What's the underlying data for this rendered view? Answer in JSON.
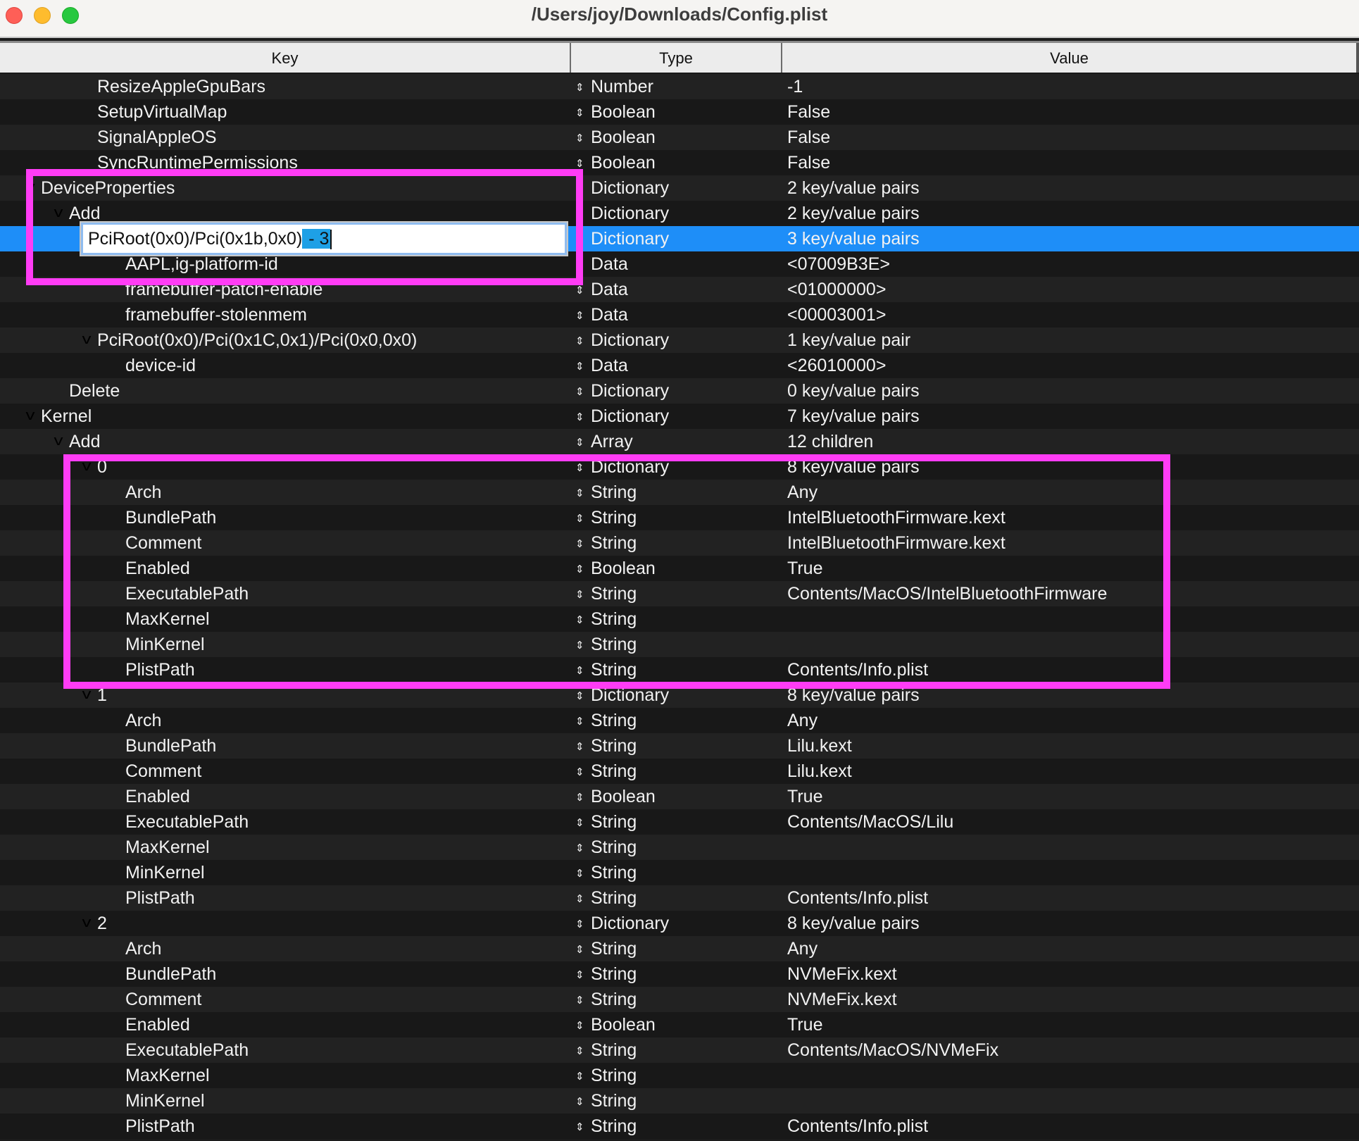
{
  "window": {
    "title": "/Users/joy/Downloads/Config.plist"
  },
  "columns": {
    "key": "Key",
    "type": "Type",
    "value": "Value"
  },
  "icons": {
    "type_stepper": "⇕",
    "disclosure_expanded": "v"
  },
  "colors": {
    "selection": "#1e8ef8",
    "highlight_box": "#ff3cf5",
    "row_light": "#222222",
    "row_dark": "#181818"
  },
  "editing": {
    "text_before": "PciRoot(0x0)/Pci(0x1b,0x0)",
    "text_selected": " - 3"
  },
  "rows": [
    {
      "key": "ResizeAppleGpuBars",
      "level": 2,
      "expanded": false,
      "type": "Number",
      "value": "-1"
    },
    {
      "key": "SetupVirtualMap",
      "level": 2,
      "expanded": false,
      "type": "Boolean",
      "value": "False"
    },
    {
      "key": "SignalAppleOS",
      "level": 2,
      "expanded": false,
      "type": "Boolean",
      "value": "False"
    },
    {
      "key": "SyncRuntimePermissions",
      "level": 2,
      "expanded": false,
      "type": "Boolean",
      "value": "False"
    },
    {
      "key": "DeviceProperties",
      "level": 0,
      "expanded": true,
      "type": "Dictionary",
      "value": "2 key/value pairs"
    },
    {
      "key": "Add",
      "level": 1,
      "expanded": true,
      "type": "Dictionary",
      "value": "2 key/value pairs"
    },
    {
      "key": "PciRoot(0x0)/Pci(0x1b,0x0) - 3",
      "level": 2,
      "expanded": true,
      "type": "Dictionary",
      "value": "3 key/value pairs",
      "selected": true,
      "editing": true
    },
    {
      "key": "AAPL,ig-platform-id",
      "level": 3,
      "expanded": false,
      "type": "Data",
      "value": "<07009B3E>"
    },
    {
      "key": "framebuffer-patch-enable",
      "level": 3,
      "expanded": false,
      "type": "Data",
      "value": "<01000000>"
    },
    {
      "key": "framebuffer-stolenmem",
      "level": 3,
      "expanded": false,
      "type": "Data",
      "value": "<00003001>"
    },
    {
      "key": "PciRoot(0x0)/Pci(0x1C,0x1)/Pci(0x0,0x0)",
      "level": 2,
      "expanded": true,
      "type": "Dictionary",
      "value": "1 key/value pair"
    },
    {
      "key": "device-id",
      "level": 3,
      "expanded": false,
      "type": "Data",
      "value": "<26010000>"
    },
    {
      "key": "Delete",
      "level": 1,
      "expanded": false,
      "type": "Dictionary",
      "value": "0 key/value pairs"
    },
    {
      "key": "Kernel",
      "level": 0,
      "expanded": true,
      "type": "Dictionary",
      "value": "7 key/value pairs"
    },
    {
      "key": "Add",
      "level": 1,
      "expanded": true,
      "type": "Array",
      "value": "12 children"
    },
    {
      "key": "0",
      "level": 2,
      "expanded": true,
      "type": "Dictionary",
      "value": "8 key/value pairs"
    },
    {
      "key": "Arch",
      "level": 3,
      "expanded": false,
      "type": "String",
      "value": "Any"
    },
    {
      "key": "BundlePath",
      "level": 3,
      "expanded": false,
      "type": "String",
      "value": "IntelBluetoothFirmware.kext"
    },
    {
      "key": "Comment",
      "level": 3,
      "expanded": false,
      "type": "String",
      "value": "IntelBluetoothFirmware.kext"
    },
    {
      "key": "Enabled",
      "level": 3,
      "expanded": false,
      "type": "Boolean",
      "value": "True"
    },
    {
      "key": "ExecutablePath",
      "level": 3,
      "expanded": false,
      "type": "String",
      "value": "Contents/MacOS/IntelBluetoothFirmware"
    },
    {
      "key": "MaxKernel",
      "level": 3,
      "expanded": false,
      "type": "String",
      "value": ""
    },
    {
      "key": "MinKernel",
      "level": 3,
      "expanded": false,
      "type": "String",
      "value": ""
    },
    {
      "key": "PlistPath",
      "level": 3,
      "expanded": false,
      "type": "String",
      "value": "Contents/Info.plist"
    },
    {
      "key": "1",
      "level": 2,
      "expanded": true,
      "type": "Dictionary",
      "value": "8 key/value pairs"
    },
    {
      "key": "Arch",
      "level": 3,
      "expanded": false,
      "type": "String",
      "value": "Any"
    },
    {
      "key": "BundlePath",
      "level": 3,
      "expanded": false,
      "type": "String",
      "value": "Lilu.kext"
    },
    {
      "key": "Comment",
      "level": 3,
      "expanded": false,
      "type": "String",
      "value": "Lilu.kext"
    },
    {
      "key": "Enabled",
      "level": 3,
      "expanded": false,
      "type": "Boolean",
      "value": "True"
    },
    {
      "key": "ExecutablePath",
      "level": 3,
      "expanded": false,
      "type": "String",
      "value": "Contents/MacOS/Lilu"
    },
    {
      "key": "MaxKernel",
      "level": 3,
      "expanded": false,
      "type": "String",
      "value": ""
    },
    {
      "key": "MinKernel",
      "level": 3,
      "expanded": false,
      "type": "String",
      "value": ""
    },
    {
      "key": "PlistPath",
      "level": 3,
      "expanded": false,
      "type": "String",
      "value": "Contents/Info.plist"
    },
    {
      "key": "2",
      "level": 2,
      "expanded": true,
      "type": "Dictionary",
      "value": "8 key/value pairs"
    },
    {
      "key": "Arch",
      "level": 3,
      "expanded": false,
      "type": "String",
      "value": "Any"
    },
    {
      "key": "BundlePath",
      "level": 3,
      "expanded": false,
      "type": "String",
      "value": "NVMeFix.kext"
    },
    {
      "key": "Comment",
      "level": 3,
      "expanded": false,
      "type": "String",
      "value": "NVMeFix.kext"
    },
    {
      "key": "Enabled",
      "level": 3,
      "expanded": false,
      "type": "Boolean",
      "value": "True"
    },
    {
      "key": "ExecutablePath",
      "level": 3,
      "expanded": false,
      "type": "String",
      "value": "Contents/MacOS/NVMeFix"
    },
    {
      "key": "MaxKernel",
      "level": 3,
      "expanded": false,
      "type": "String",
      "value": ""
    },
    {
      "key": "MinKernel",
      "level": 3,
      "expanded": false,
      "type": "String",
      "value": ""
    },
    {
      "key": "PlistPath",
      "level": 3,
      "expanded": false,
      "type": "String",
      "value": "Contents/Info.plist"
    }
  ]
}
